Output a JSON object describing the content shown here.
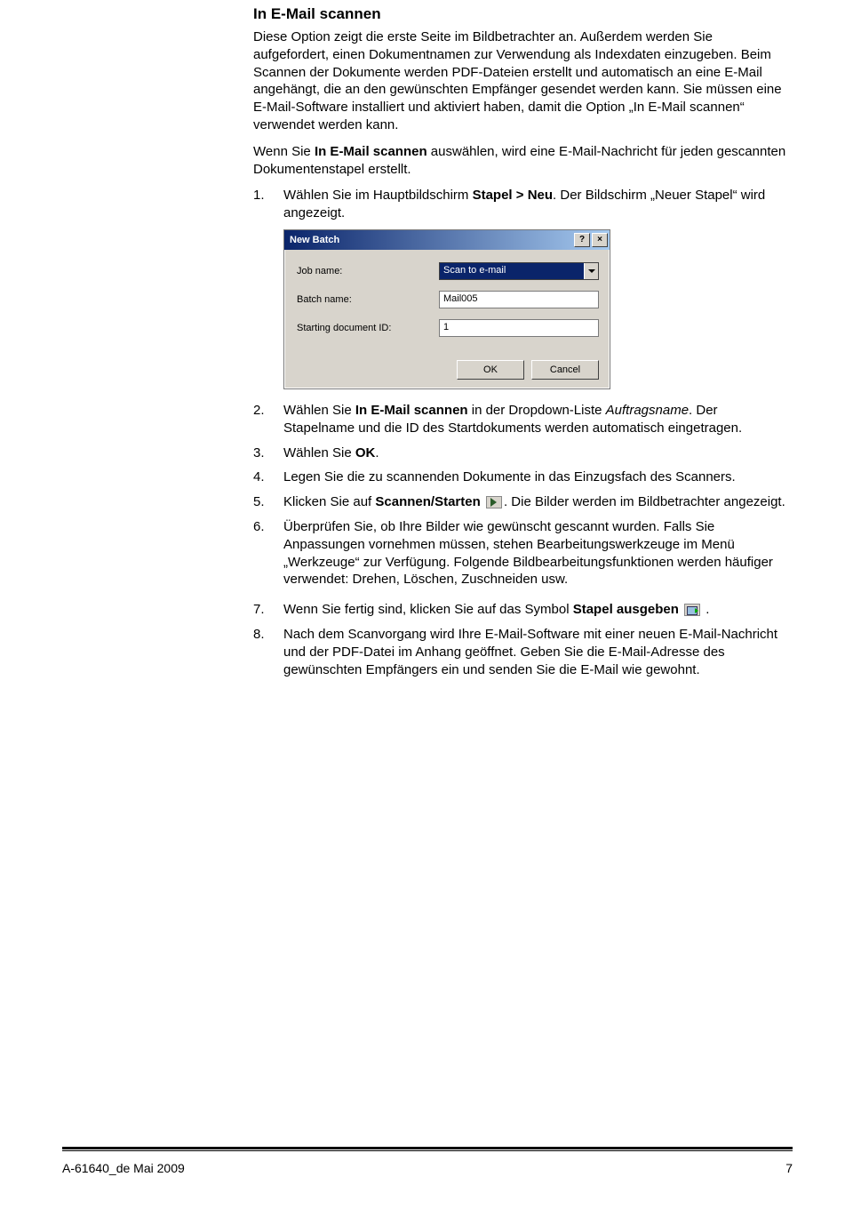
{
  "heading": "In E-Mail scannen",
  "intro1": "Diese Option zeigt die erste Seite im Bildbetrachter an. Außerdem werden Sie aufgefordert, einen Dokumentnamen zur Verwendung als Indexdaten einzugeben. Beim Scannen der Dokumente werden PDF-Dateien erstellt und automatisch an eine E-Mail angehängt, die an den gewünschten Empfänger gesendet werden kann. Sie müssen eine E-Mail-Software installiert und aktiviert haben, damit die Option „In E-Mail scannen“ verwendet werden kann.",
  "intro2_a": "Wenn Sie ",
  "intro2_bold": "In E-Mail scannen",
  "intro2_b": " auswählen, wird eine E-Mail-Nachricht für jeden gescannten Dokumentenstapel erstellt.",
  "steps": {
    "s1_a": "Wählen Sie im Hauptbildschirm ",
    "s1_bold": "Stapel > Neu",
    "s1_b": ". Der Bildschirm „Neuer Stapel“ wird angezeigt.",
    "s2_a": "Wählen Sie ",
    "s2_bold": "In E-Mail scannen",
    "s2_b": " in der Dropdown-Liste ",
    "s2_italic": "Auftragsname",
    "s2_c": ". Der Stapelname und die ID des Startdokuments werden automatisch eingetragen.",
    "s3_a": "Wählen Sie ",
    "s3_bold": "OK",
    "s3_b": ".",
    "s4": "Legen Sie die zu scannenden Dokumente in das Einzugsfach des Scanners.",
    "s5_a": "Klicken Sie auf ",
    "s5_bold": "Scannen/Starten",
    "s5_b": ". Die Bilder werden im Bildbetrachter angezeigt.",
    "s6": "Überprüfen Sie, ob Ihre Bilder wie gewünscht gescannt wurden. Falls Sie Anpassungen vornehmen müssen, stehen Bearbeitungswerkzeuge im Menü „Werkzeuge“ zur Verfügung. Folgende Bildbearbeitungsfunktionen werden häufiger verwendet: Drehen, Löschen, Zuschneiden usw.",
    "s7_a": "Wenn Sie fertig sind, klicken Sie auf das Symbol ",
    "s7_bold": "Stapel ausgeben",
    "s7_b": " .",
    "s8": "Nach dem Scanvorgang wird Ihre E-Mail-Software mit einer neuen E-Mail-Nachricht und der PDF-Datei im Anhang geöffnet. Geben Sie die E-Mail-Adresse des gewünschten Empfängers ein und senden Sie die E-Mail wie gewohnt."
  },
  "numbers": {
    "n1": "1.",
    "n2": "2.",
    "n3": "3.",
    "n4": "4.",
    "n5": "5.",
    "n6": "6.",
    "n7": "7.",
    "n8": "8."
  },
  "dialog": {
    "title": "New Batch",
    "help": "?",
    "close": "×",
    "job_label": "Job name:",
    "job_value": "Scan to e-mail",
    "batch_label": "Batch name:",
    "batch_value": "Mail005",
    "start_label": "Starting document ID:",
    "start_value": "1",
    "ok": "OK",
    "cancel": "Cancel"
  },
  "footer": {
    "left": "A-61640_de  Mai 2009",
    "right": "7"
  }
}
